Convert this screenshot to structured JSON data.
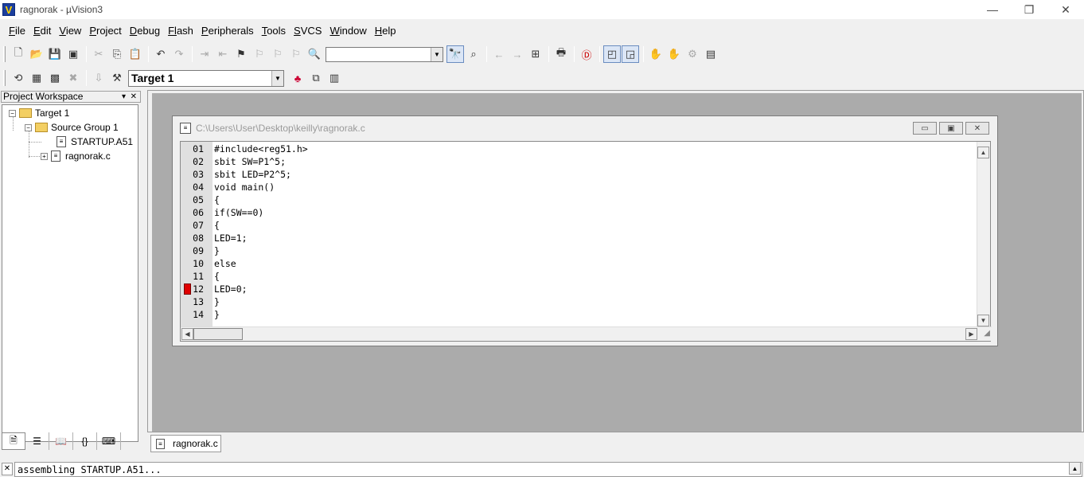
{
  "window": {
    "logo": "V",
    "title": "ragnorak  - µVision3",
    "controls": [
      "—",
      "❐",
      "✕"
    ]
  },
  "menu": [
    {
      "key": "F",
      "rest": "ile"
    },
    {
      "key": "E",
      "rest": "dit"
    },
    {
      "key": "V",
      "rest": "iew"
    },
    {
      "key": "P",
      "rest": "roject"
    },
    {
      "key": "D",
      "rest": "ebug"
    },
    {
      "key": "Fl",
      "rest": "ash"
    },
    {
      "key": "P",
      "rest": "eripherals"
    },
    {
      "key": "T",
      "rest": "ools"
    },
    {
      "key": "S",
      "rest": "VCS"
    },
    {
      "key": "W",
      "rest": "indow"
    },
    {
      "key": "H",
      "rest": "elp"
    }
  ],
  "toolbar": {
    "find_value": "",
    "target_value": "Target 1"
  },
  "workspace": {
    "title": "Project Workspace",
    "pin": "▾",
    "close": "✕",
    "tree": {
      "target": "Target 1",
      "group": "Source Group 1",
      "files": [
        "STARTUP.A51",
        "ragnorak.c"
      ]
    },
    "tabs": [
      "files-tab",
      "regs-tab",
      "books-tab",
      "functions-tab",
      "templates-tab"
    ]
  },
  "editor": {
    "path": "C:\\Users\\User\\Desktop\\keilly\\ragnorak.c",
    "lines": [
      {
        "no": "01",
        "code": "#include<reg51.h>",
        "breakpoint": false
      },
      {
        "no": "02",
        "code": "sbit SW=P1^5;",
        "breakpoint": false
      },
      {
        "no": "03",
        "code": "sbit LED=P2^5;",
        "breakpoint": false
      },
      {
        "no": "04",
        "code": "void main()",
        "breakpoint": false
      },
      {
        "no": "05",
        "code": "{",
        "breakpoint": false
      },
      {
        "no": "06",
        "code": "if(SW==0)",
        "breakpoint": false
      },
      {
        "no": "07",
        "code": "{",
        "breakpoint": false
      },
      {
        "no": "08",
        "code": "LED=1;",
        "breakpoint": false
      },
      {
        "no": "09",
        "code": "}",
        "breakpoint": false
      },
      {
        "no": "10",
        "code": "else",
        "breakpoint": false
      },
      {
        "no": "11",
        "code": "{",
        "breakpoint": false
      },
      {
        "no": "12",
        "code": "LED=0;",
        "breakpoint": true
      },
      {
        "no": "13",
        "code": "}",
        "breakpoint": false
      },
      {
        "no": "14",
        "code": "}",
        "breakpoint": false
      }
    ]
  },
  "doc_tab": {
    "label": "ragnorak.c"
  },
  "output": {
    "text": "assembling STARTUP.A51..."
  },
  "colors": {
    "breakpoint": "#e00000",
    "mdi_background": "#ababab",
    "title_path": "#9a9a9a"
  }
}
